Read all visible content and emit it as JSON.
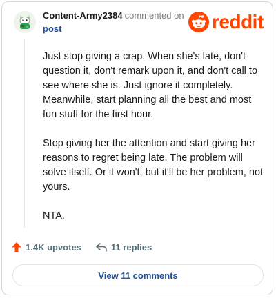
{
  "comment": {
    "username": "Content-Army2384",
    "action_text": "commented on",
    "target_text": "post",
    "paragraphs": [
      "Just stop giving a crap. When she's late, don't question it, don't remark upon it, and don't call to see where she is. Just ignore it completely. Meanwhile, start planning all the best and most fun stuff for the first hour.",
      "Stop giving her the attention and start giving her reasons to regret being late. The problem will solve itself. Or it won't, but it'll be her problem, not yours.",
      "NTA."
    ]
  },
  "brand": {
    "wordmark": "reddit",
    "color": "#ff4500",
    "icon": "reddit-snoo-icon"
  },
  "footer": {
    "upvotes": "1.4K upvotes",
    "replies": "11 replies",
    "view_comments": "View 11 comments"
  },
  "colors": {
    "link": "#1f4f9a",
    "upvote": "#ff4500",
    "muted": "#576f76"
  }
}
